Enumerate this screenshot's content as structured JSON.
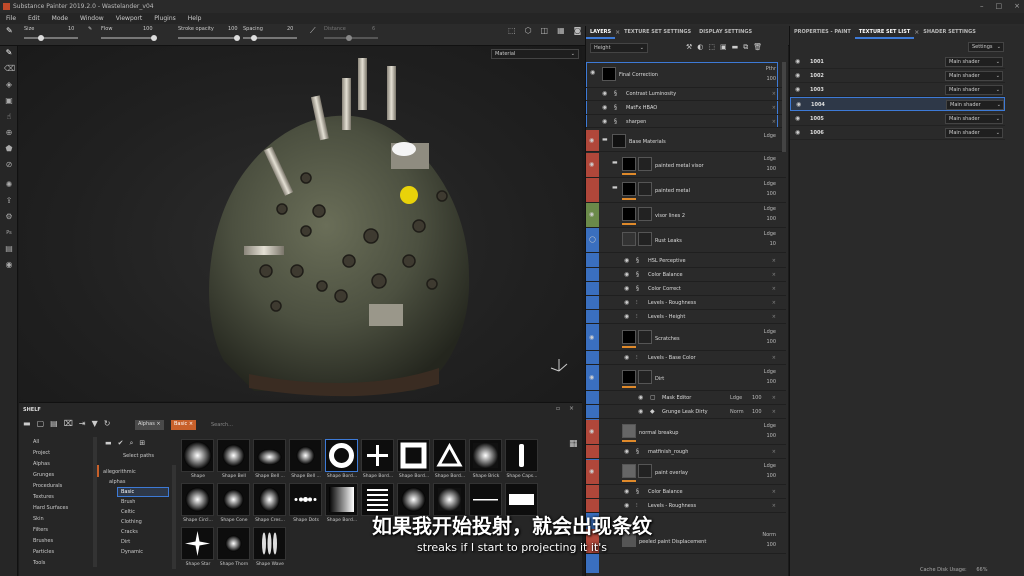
{
  "window": {
    "title": "Substance Painter 2019.2.0 - Wastelander_v04"
  },
  "menu": [
    "File",
    "Edit",
    "Mode",
    "Window",
    "Viewport",
    "Plugins",
    "Help"
  ],
  "tool_options": {
    "size_label": "Size",
    "size_value": "10",
    "flow_label": "Flow",
    "flow_value": "100",
    "stroke_opacity_label": "Stroke opacity",
    "stroke_opacity_value": "100",
    "spacing_label": "Spacing",
    "spacing_value": "20",
    "distance_label": "Distance",
    "distance_value": "6"
  },
  "viewport": {
    "mode_select": "Material"
  },
  "layers_panel": {
    "tabs": [
      "LAYERS",
      "TEXTURE SET SETTINGS",
      "DISPLAY SETTINGS"
    ],
    "channel_select": "Height",
    "rows": [
      {
        "name": "Final Correction",
        "blend": "Pthr",
        "opacity": "100"
      },
      {
        "name": "Contrast Luminosity"
      },
      {
        "name": "MatFx HBAO"
      },
      {
        "name": "sharpen"
      },
      {
        "name": "Base Materials",
        "blend": "Ldge"
      },
      {
        "name": "painted metal visor",
        "blend": "Ldge",
        "opacity": "100"
      },
      {
        "name": "painted metal",
        "blend": "Ldge",
        "opacity": "100"
      },
      {
        "name": "visor lines 2",
        "blend": "Ldge",
        "opacity": "100"
      },
      {
        "name": "Rust Leaks",
        "blend": "Ldge",
        "opacity": "10"
      },
      {
        "name": "HSL Perceptive"
      },
      {
        "name": "Color Balance"
      },
      {
        "name": "Color Correct"
      },
      {
        "name": "Levels - Roughness"
      },
      {
        "name": "Levels - Height"
      },
      {
        "name": "Scratches",
        "blend": "Ldge",
        "opacity": "100"
      },
      {
        "name": "Levels - Base Color"
      },
      {
        "name": "Dirt",
        "blend": "Ldge",
        "opacity": "100"
      },
      {
        "name": "Mask Editor",
        "blend": "Ldge",
        "opacity": "100"
      },
      {
        "name": "Grunge Leak Dirty",
        "blend": "Norm",
        "opacity": "100"
      },
      {
        "name": "normal breakup",
        "blend": "Ldge",
        "opacity": "100"
      },
      {
        "name": "matfinish_rough"
      },
      {
        "name": "paint overlay",
        "blend": "Ldge",
        "opacity": "100"
      },
      {
        "name": "Color Balance"
      },
      {
        "name": "Levels - Roughness"
      },
      {
        "name": "peeled paint Displacement",
        "blend": "Norm",
        "opacity": "100"
      }
    ]
  },
  "texture_set_panel": {
    "tabs": [
      "PROPERTIES - PAINT",
      "TEXTURE SET LIST",
      "SHADER SETTINGS"
    ],
    "settings_button": "Settings",
    "sets": [
      {
        "name": "1001",
        "shader": "Main shader"
      },
      {
        "name": "1002",
        "shader": "Main shader"
      },
      {
        "name": "1003",
        "shader": "Main shader"
      },
      {
        "name": "1004",
        "shader": "Main shader"
      },
      {
        "name": "1005",
        "shader": "Main shader"
      },
      {
        "name": "1006",
        "shader": "Main shader"
      }
    ]
  },
  "shelf": {
    "title": "SHELF",
    "filter_tags": [
      "Alphas",
      "Basic"
    ],
    "search_placeholder": "Search...",
    "categories": [
      "All",
      "Project",
      "Alphas",
      "Grunges",
      "Procedurals",
      "Textures",
      "Hard Surfaces",
      "Skin",
      "Filters",
      "Brushes",
      "Particles",
      "Tools"
    ],
    "select_paths": "Select paths",
    "tree": [
      "allegorithmic",
      "alphas",
      "Basic",
      "Brush",
      "Celtic",
      "Clothing",
      "Cracks",
      "Dirt",
      "Dynamic"
    ],
    "alphas": [
      "Shape",
      "Shape Bell",
      "Shape Bell ...",
      "Shape Bell ...",
      "Shape Bord...",
      "Shape Bord...",
      "Shape Bord...",
      "Shape Bord...",
      "Shape Brick",
      "Shape Caps...",
      "Shape Circl...",
      "Shape Cone",
      "Shape Cres...",
      "Shape Dots",
      "Shape Bord...",
      "",
      "",
      "",
      "",
      "",
      "Shape Star",
      "Shape Thorn",
      "Shape Wave"
    ]
  },
  "subtitles": {
    "cn": "如果我开始投射，就会出现条纹",
    "en": "streaks if I start to projecting it it's"
  },
  "status": {
    "cache": "Cache Disk Usage:",
    "cache_value": "66%"
  },
  "colors": {
    "accent": "#3d7ad6",
    "orange": "#e08a2a",
    "red_group": "#b0473a",
    "green_group": "#6b8a4a",
    "blue_group": "#3a6fbf"
  }
}
